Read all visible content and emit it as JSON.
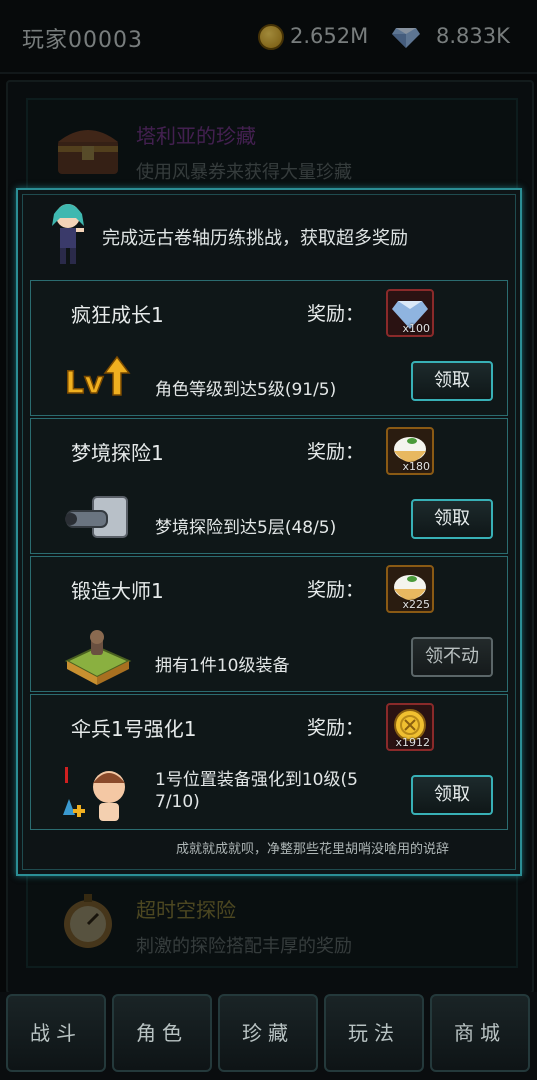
{
  "topbar": {
    "player_name": "玩家00003",
    "coin_value": "2.652M",
    "gem_value": "8.833K",
    "coin_icon": "gold-coin-icon",
    "gem_icon": "diamond-icon"
  },
  "background_cards": [
    {
      "title": "塔利亚的珍藏",
      "desc": "使用风暴券来获得大量珍藏",
      "title_color": "#b04ad0",
      "icon": "treasure-chest-icon"
    },
    {
      "title": "超时空探险",
      "desc": "刺激的探险搭配丰厚的奖励",
      "title_color": "#c9b74a",
      "icon": "stopwatch-icon"
    }
  ],
  "popup": {
    "header": "完成远古卷轴历练挑战，获取超多奖励",
    "reward_label": "奖励：",
    "footnote": "成就就成就呗，净整那些花里胡哨没啥用的说辞",
    "tasks": [
      {
        "name": "疯狂成长1",
        "desc": "角色等级到达5级(91/5)",
        "reward_count": "x100",
        "reward_icon": "diamond-reward-icon",
        "button": "领取",
        "icon": "level-up-icon"
      },
      {
        "name": "梦境探险1",
        "desc": "梦境探险到达5层(48/5)",
        "reward_count": "x180",
        "reward_icon": "rice-bowl-reward-icon",
        "button": "领取",
        "icon": "cannon-icon"
      },
      {
        "name": "锻造大师1",
        "desc": "拥有1件10级装备",
        "reward_count": "x225",
        "reward_icon": "rice-bowl-reward-icon",
        "button": "领不动",
        "icon": "anvil-icon"
      },
      {
        "name": "伞兵1号强化1",
        "desc": "1号位置装备强化到10级(5 7/10)",
        "desc_line1": "1号位置装备强化到10级(5",
        "desc_line2": "7/10)",
        "reward_count": "x1912",
        "reward_icon": "gold-coin-reward-icon",
        "button": "领取",
        "icon": "enhance-character-icon"
      }
    ]
  },
  "tabs": [
    "战斗",
    "角色",
    "珍藏",
    "玩法",
    "商城"
  ]
}
